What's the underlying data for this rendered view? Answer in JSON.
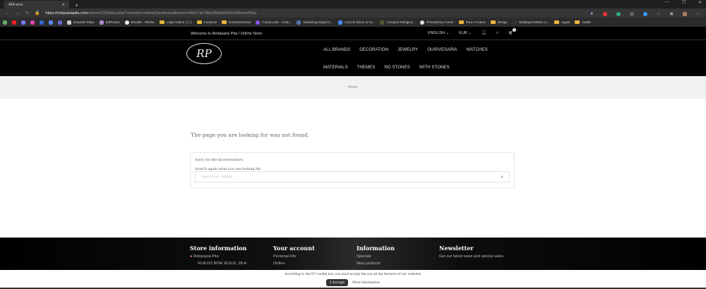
{
  "browser": {
    "tab_title": "404 error",
    "url_host": "https://relojoariapita.com",
    "url_path": "/admin123/index.php?controller=AdminDashboard&token=68d17dc78ba35b5e605901840ee4f59a",
    "bookmarks": [
      "Eduardo Filipe",
      "EdPhotos",
      "Moodle - IPleiria",
      "Lojas Online ( C )",
      "Compras",
      "Entretenimento",
      "Colourcode - Color...",
      "Marketing Digital C...",
      "G11CD Driver & Tu...",
      "Comprar Relógios...",
      "PrestaShop Forum",
      "Para o Futuro",
      "Design",
      "WallpapersWide.co...",
      "Jogos",
      "Outlet"
    ]
  },
  "topbar": {
    "welcome": "Welcome to Relojoaria Pita / Online Store",
    "language": "ENGLISH ⌄",
    "currency": "EUR ⌄",
    "cart_count": "0"
  },
  "nav": {
    "row1": [
      "ALL BRANDS",
      "DECORATION",
      "JEWELRY",
      "OURIVESARIA",
      "WATCHES"
    ],
    "row2": [
      "MATERIALS",
      "THEMES",
      "NO STONES",
      "WITH STONES"
    ],
    "logo": "RP"
  },
  "breadcrumb": "Home",
  "main": {
    "title": "The page you are looking for was not found.",
    "sorry": "Sorry for the inconvenience.",
    "search_label": "Search again what you are looking for",
    "search_placeholder": "Search our catalog"
  },
  "footer": {
    "store": {
      "title": "Store information",
      "name": "Relojoaria Pita",
      "address": "RUA DO BOM JESUS, 28-A"
    },
    "account": {
      "title": "Your account",
      "links": [
        "Personal info",
        "Orders"
      ]
    },
    "info": {
      "title": "Information",
      "links": [
        "Specials",
        "New products"
      ]
    },
    "newsletter": {
      "title": "Newsletter",
      "text": "Get our latest news and special sales"
    }
  },
  "cookie": {
    "text": "According to the EU cookie law, you must accept the use all the features of our websites",
    "accept": "I Accept",
    "more": "More Information"
  }
}
